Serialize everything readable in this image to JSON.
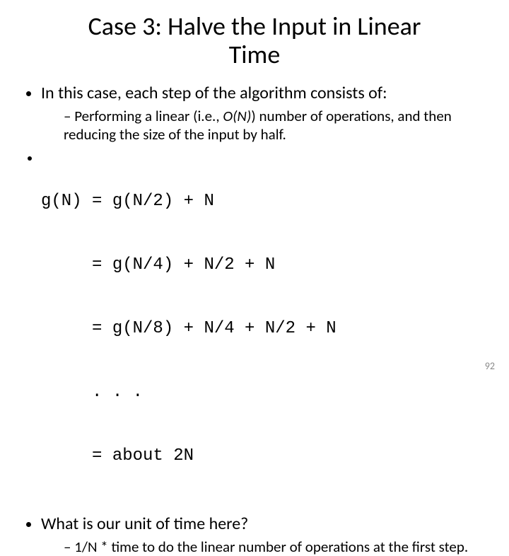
{
  "title": "Case 3: Halve the Input in Linear Time",
  "bullets": {
    "b1": "In this case, each step of the algorithm consists of:",
    "b1a_pre": "Performing a linear (i.e., ",
    "b1a_on": "O(N)",
    "b1a_post": ") number of operations, and then reducing the size of the input by half.",
    "code1": "g(N) = g(N/2) + N",
    "code2": "     = g(N/4) + N/2 + N",
    "code3": "     = g(N/8) + N/4 + N/2 + N",
    "code4": "     . . .",
    "code5": "     = about 2N",
    "b3": "What is our unit of time here?",
    "b3a": "1/N * time to do the linear number of operations at the first step."
  },
  "page_number": "92"
}
